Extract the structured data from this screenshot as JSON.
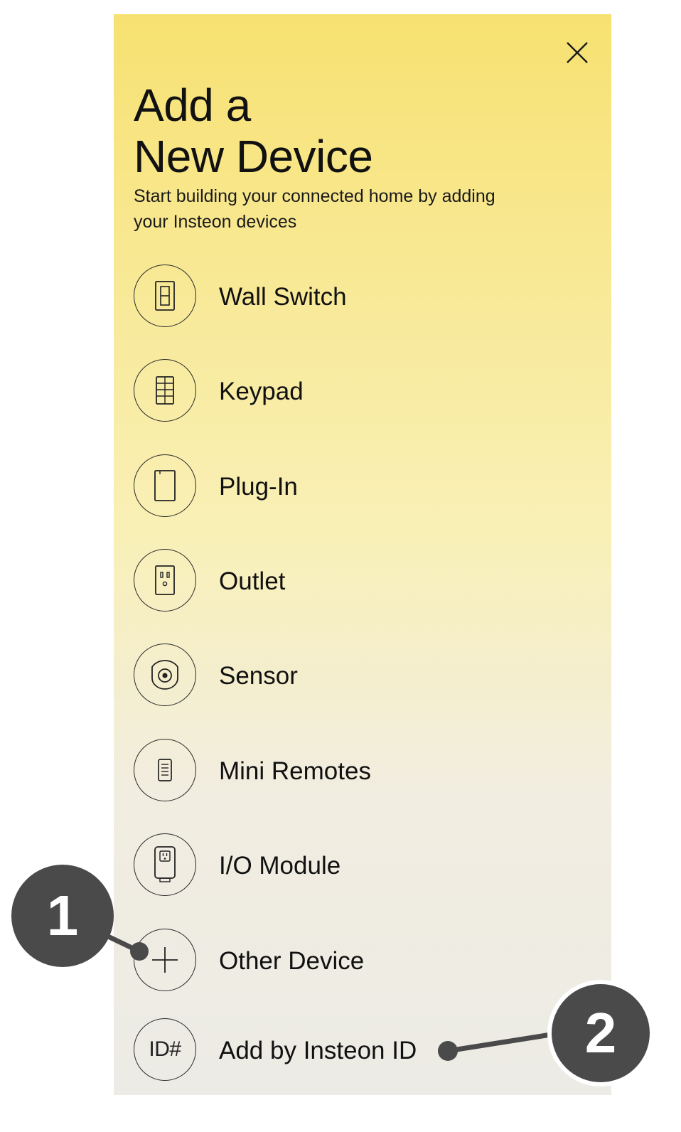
{
  "header": {
    "title_line1": "Add a",
    "title_line2": "New Device",
    "subtitle": "Start building your connected home by adding your Insteon devices",
    "close_icon": "close-icon"
  },
  "devices": [
    {
      "label": "Wall Switch",
      "icon": "wall-switch-icon"
    },
    {
      "label": "Keypad",
      "icon": "keypad-icon"
    },
    {
      "label": "Plug-In",
      "icon": "plug-in-icon"
    },
    {
      "label": "Outlet",
      "icon": "outlet-icon"
    },
    {
      "label": "Sensor",
      "icon": "sensor-icon"
    },
    {
      "label": "Mini Remotes",
      "icon": "mini-remote-icon"
    },
    {
      "label": "I/O Module",
      "icon": "io-module-icon"
    },
    {
      "label": "Other Device",
      "icon": "plus-icon"
    },
    {
      "label": "Add by Insteon ID",
      "icon": "id-icon",
      "icon_text": "ID#"
    }
  ],
  "callouts": [
    {
      "number": "1"
    },
    {
      "number": "2"
    }
  ],
  "colors": {
    "gradient_top": "#f7e171",
    "gradient_mid": "#f9f0b7",
    "gradient_bottom": "#ecebe5",
    "callout": "#4a4a4a",
    "text": "#111111"
  }
}
